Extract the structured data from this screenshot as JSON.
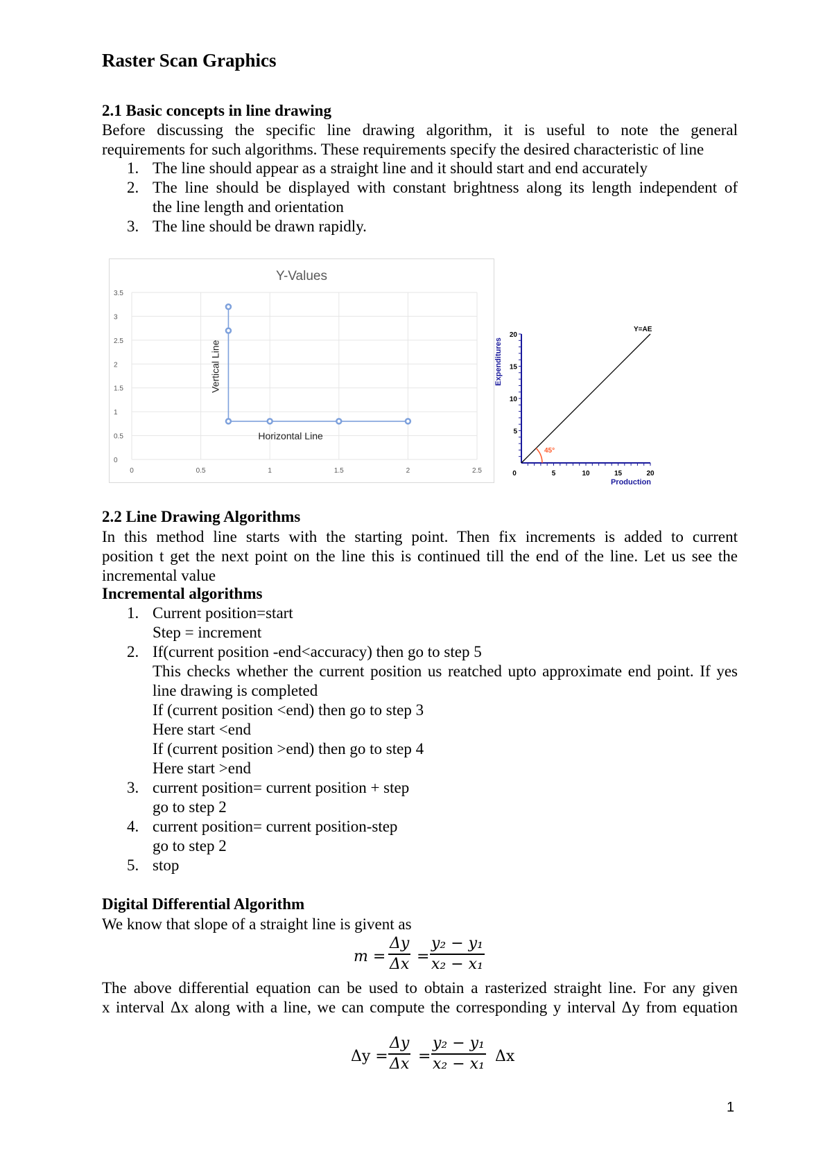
{
  "document": {
    "title": "Raster Scan Graphics",
    "page_number": "1"
  },
  "section_2_1": {
    "heading": "2.1 Basic concepts in line drawing",
    "para_lines": [
      "Before discussing the specific line drawing algorithm, it is useful to note the general",
      "requirements for such algorithms. These requirements specify the desired characteristic of line"
    ],
    "list": [
      {
        "num": "1.",
        "lines": [
          "The line should appear as a straight line and it should start and end accurately"
        ]
      },
      {
        "num": "2.",
        "lines": [
          "The line should be displayed with constant brightness along its length independent of",
          "the line length and orientation"
        ]
      },
      {
        "num": "3.",
        "lines": [
          "The line should be drawn rapidly."
        ]
      }
    ]
  },
  "chart_data": [
    {
      "type": "scatter",
      "title": "Y-Values",
      "xlabel": "",
      "ylabel": "",
      "xlim": [
        0,
        2.5
      ],
      "ylim": [
        0,
        3.5
      ],
      "x_ticks": [
        "0",
        "0.5",
        "1",
        "1.5",
        "2",
        "2.5"
      ],
      "y_ticks": [
        "0",
        "0.5",
        "1",
        "1.5",
        "2",
        "2.5",
        "3",
        "3.5"
      ],
      "grid": true,
      "series": [
        {
          "name": "Y-Values",
          "color": "#7ea1dc",
          "points": [
            [
              0.7,
              3.2
            ],
            [
              0.7,
              2.7
            ],
            [
              0.7,
              0.8
            ],
            [
              1,
              0.8
            ],
            [
              1.5,
              0.8
            ],
            [
              2,
              0.8
            ]
          ]
        }
      ],
      "annotations": [
        {
          "text": "Vertical Line",
          "rotation": "vertical"
        },
        {
          "text": "Horizontal Line",
          "rotation": "horizontal"
        }
      ]
    },
    {
      "type": "line",
      "title": "",
      "xlabel": "Production",
      "ylabel": "Expenditures",
      "xlim": [
        0,
        20
      ],
      "ylim": [
        0,
        20
      ],
      "x_ticks": [
        "0",
        "5",
        "10",
        "15",
        "20"
      ],
      "y_ticks": [
        "5",
        "10",
        "15",
        "20"
      ],
      "grid": false,
      "series": [
        {
          "name": "Y=AE",
          "color": "#000000",
          "points": [
            [
              0,
              0
            ],
            [
              20,
              20
            ]
          ]
        }
      ],
      "annotations": [
        {
          "text": "45°",
          "color": "#ff5a2a"
        },
        {
          "text": "Y=AE"
        }
      ],
      "axis_color": "#1a1a9c"
    }
  ],
  "section_2_2": {
    "heading": "2.2 Line Drawing Algorithms",
    "para_lines": [
      "In this method line starts with the starting point. Then fix increments is added to current",
      "position t get the next point on the line this is continued till the end of the line. Let us see the",
      "incremental value"
    ],
    "sub_heading": "Incremental algorithms",
    "steps": [
      {
        "num": "1.",
        "lines": [
          "Current position=start",
          "Step = increment"
        ]
      },
      {
        "num": "2.",
        "lines": [
          "If(current position -end<accuracy) then go to step 5",
          "This checks whether the current position us reatched upto approximate end point. If yes",
          "line drawing is completed",
          "If (current position <end) then go to step 3",
          "Here start <end",
          "If (current position >end) then go to step 4",
          "Here start >end"
        ]
      },
      {
        "num": "3.",
        "lines": [
          "current position= current position + step",
          "go to step 2"
        ]
      },
      {
        "num": "4.",
        "lines": [
          "current position= current position-step",
          "go to step 2"
        ]
      },
      {
        "num": "5.",
        "lines": [
          "stop"
        ]
      }
    ]
  },
  "dda": {
    "heading": "Digital Differential Algorithm",
    "intro": "We know that slope of a straight line is givent as",
    "eq1": {
      "lhs": "m =",
      "f1_num": "Δy",
      "f1_den": "Δx",
      "eq": "=",
      "f2_num": "y₂ − y₁",
      "f2_den": "x₂ − x₁"
    },
    "para_lines": [
      "The above differential equation can be used to obtain a rasterized straight line. For any given",
      "x interval Δx along with a line, we can compute the corresponding y interval Δy from equation"
    ],
    "eq2": {
      "lhs": "Δy =",
      "f1_num": "Δy",
      "f1_den": "Δx",
      "eq": "=",
      "f2_num": "y₂ − y₁",
      "f2_den": "x₂ − x₁",
      "tail": "Δx"
    }
  }
}
